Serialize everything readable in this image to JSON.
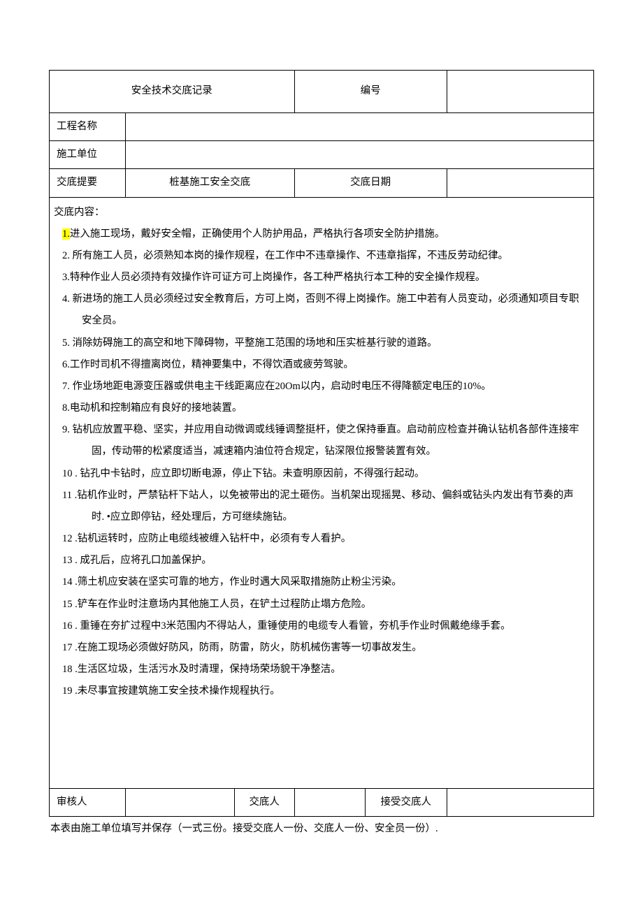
{
  "header": {
    "title": "安全技术交底记录",
    "serial_label": "编号",
    "serial_value": ""
  },
  "fields": {
    "project_name_label": "工程名称",
    "project_name_value": "",
    "constructor_label": "施工单位",
    "constructor_value": "",
    "summary_label": "交底提要",
    "summary_value": "桩基施工安全交底",
    "date_label": "交底日期",
    "date_value": ""
  },
  "content": {
    "heading": "交底内容：",
    "first_num_highlight": "1.",
    "first_rest": "进入施工现场，戴好安全帽，正确使用个人防护用品，严格执行各项安全防护措施。",
    "item2": "2. 所有施工人员，必须熟知本岗的操作规程，在工作中不违章操作、不违章指挥，不违反劳动纪律。",
    "item3": "3.特种作业人员必须持有效操作许可证方可上岗操作，各工种严格执行本工种的安全操作规程。",
    "item4a": "4. 新进场的施工人员必须经过安全教育后，方可上岗，否则不得上岗操作。施工中若有人员变动，必须通知项目专职",
    "item4b": "安全员。",
    "item5": "5. 消除妨碍施工的高空和地下障碍物，平整施工范围的场地和压实桩基行驶的道路。",
    "item6": "6.工作时司机不得擅离岗位，精神要集中，不得饮酒或疲劳驾驶。",
    "item7": "7. 作业场地距电源变压器或供电主干线距离应在20Om以内，启动时电压不得降额定电压的10%。",
    "item8": "8.电动机和控制箱应有良好的接地装置。",
    "item9a": "9. 钻机应放置平稳、坚实，并应用自动微调或线锤调整挺杆，使之保持垂直。启动前应检查并确认钻机各部件连接牢",
    "item9b": "固，传动带的松紧度适当，减速箱内油位符合规定，钻深限位报警装置有效。",
    "item10": "10 . 钻孔中卡钻时，应立即切断电源，停止下钻。未查明原因前，不得强行起动。",
    "item11a": "11 .钻机作业时，严禁钻杆下站人，以免被带出的泥土砸伤。当机架出现摇晃、移动、偏斜或钻头内发出有节奏的声",
    "item11b": "时. •应立即停钻，经处理后，方可继续施钻。",
    "item12": "12 .钻机运转时，应防止电缆线被缠入钻杆中，必须有专人看护。",
    "item13": "13 . 成孔后，应将孔口加盖保护。",
    "item14": "14 .筛土机应安装在坚实可靠的地方，作业时遇大风采取措施防止粉尘污染。",
    "item15": "15 .铲车在作业时注意场内其他施工人员，在铲土过程防止塌方危险。",
    "item16": "16 . 重锤在夯扩过程中3米范围内不得站人，重锤使用的电缆专人看管，夯机手作业时佩戴绝缘手套。",
    "item17": "17 .在施工现场必须做好防风，防雨，防雷，防火，防机械伤害等一切事故发生。",
    "item18": "18 .生活区垃圾，生活污水及时清理，保持场荣场貌干净整洁。",
    "item19": "19 .未尽事宜按建筑施工安全技术操作规程执行。"
  },
  "signatures": {
    "reviewer_label": "审核人",
    "reviewer_value": "",
    "discloser_label": "交底人",
    "discloser_value": "",
    "receiver_label": "接受交底人",
    "receiver_value": ""
  },
  "footnote": "本表由施工单位填写并保存（一式三份。接受交底人一份、交底人一份、安全员一份）."
}
